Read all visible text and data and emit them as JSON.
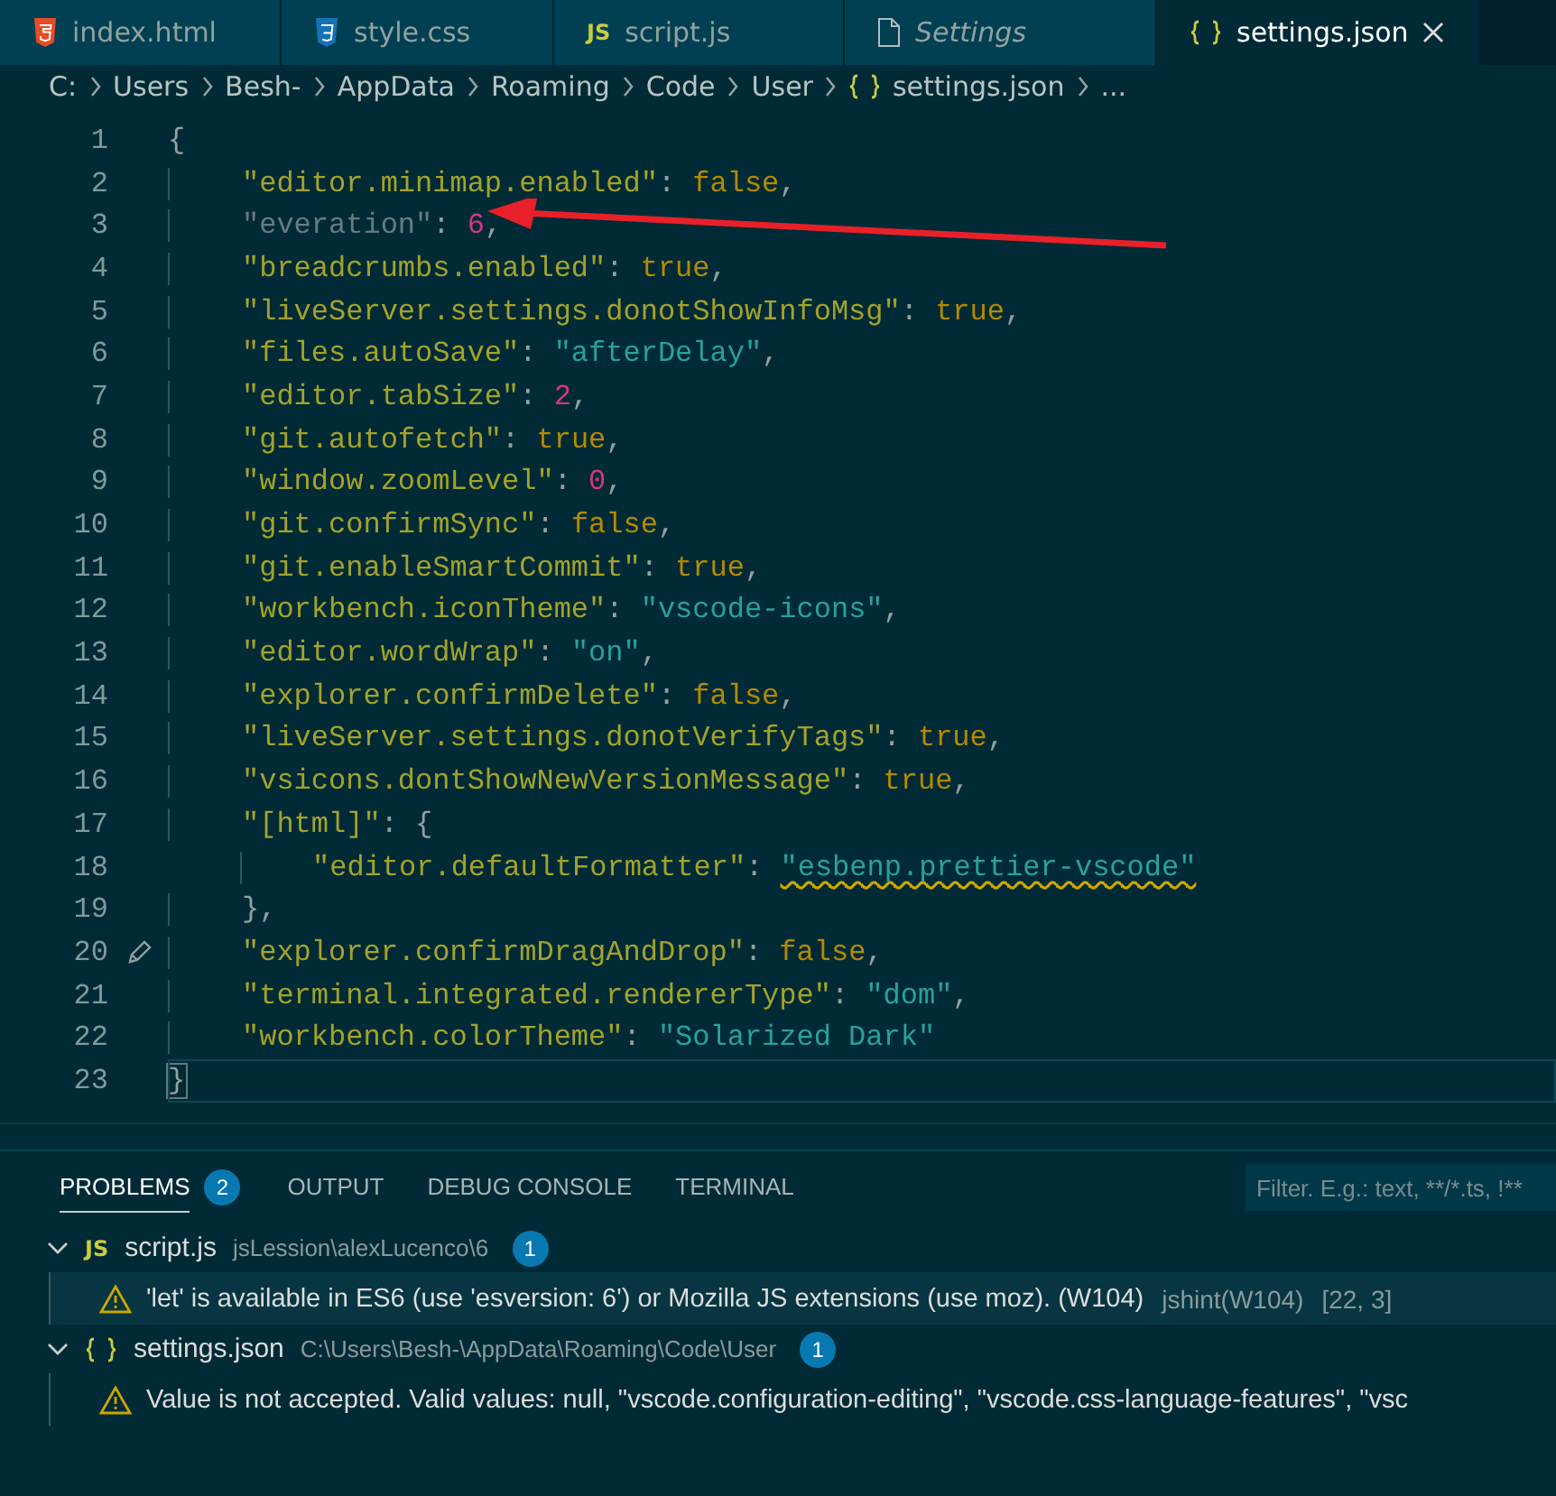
{
  "tabs": [
    {
      "label": "index.html",
      "kind": "html",
      "selected": false,
      "preview": false
    },
    {
      "label": "style.css",
      "kind": "css",
      "selected": false,
      "preview": false
    },
    {
      "label": "script.js",
      "kind": "script",
      "icon_text": "JS",
      "selected": false,
      "preview": false
    },
    {
      "label": "Settings",
      "kind": "plain",
      "selected": false,
      "preview": true
    },
    {
      "label": "settings.json",
      "kind": "braces",
      "selected": true,
      "preview": false
    }
  ],
  "breadcrumbs": [
    {
      "label": "C:",
      "kind": "folder"
    },
    {
      "label": "Users",
      "kind": "folder"
    },
    {
      "label": "Besh-",
      "kind": "folder"
    },
    {
      "label": "AppData",
      "kind": "folder"
    },
    {
      "label": "Roaming",
      "kind": "folder"
    },
    {
      "label": "Code",
      "kind": "folder"
    },
    {
      "label": "User",
      "kind": "folder"
    },
    {
      "label": "settings.json",
      "kind": "braces"
    },
    {
      "label": "...",
      "kind": "folder"
    }
  ],
  "editor": {
    "lines": [
      {
        "n": "1",
        "kind": "brace",
        "text": "{",
        "current": false
      },
      {
        "n": "2",
        "kind": "entry",
        "key": "\"editor.minimap.enabled\"",
        "colon": ":",
        "value": {
          "kind": "boolean",
          "text": "false"
        },
        "comma": ",",
        "unknown": false,
        "warning": false,
        "edited": false
      },
      {
        "n": "3",
        "kind": "entry",
        "key": "\"everation\"",
        "colon": ":",
        "value": {
          "kind": "number",
          "text": "6"
        },
        "comma": ",",
        "unknown": true,
        "warning": false,
        "edited": false
      },
      {
        "n": "4",
        "kind": "entry",
        "key": "\"breadcrumbs.enabled\"",
        "colon": ":",
        "value": {
          "kind": "boolean",
          "text": "true"
        },
        "comma": ",",
        "unknown": false,
        "warning": false,
        "edited": false
      },
      {
        "n": "5",
        "kind": "entry",
        "key": "\"liveServer.settings.donotShowInfoMsg\"",
        "colon": ":",
        "value": {
          "kind": "boolean",
          "text": "true"
        },
        "comma": ",",
        "unknown": false,
        "warning": false,
        "edited": false
      },
      {
        "n": "6",
        "kind": "entry",
        "key": "\"files.autoSave\"",
        "colon": ":",
        "value": {
          "kind": "string",
          "text": "\"afterDelay\""
        },
        "comma": ",",
        "unknown": false,
        "warning": false,
        "edited": false
      },
      {
        "n": "7",
        "kind": "entry",
        "key": "\"editor.tabSize\"",
        "colon": ":",
        "value": {
          "kind": "number",
          "text": "2"
        },
        "comma": ",",
        "unknown": false,
        "warning": false,
        "edited": false
      },
      {
        "n": "8",
        "kind": "entry",
        "key": "\"git.autofetch\"",
        "colon": ":",
        "value": {
          "kind": "boolean",
          "text": "true"
        },
        "comma": ",",
        "unknown": false,
        "warning": false,
        "edited": false
      },
      {
        "n": "9",
        "kind": "entry",
        "key": "\"window.zoomLevel\"",
        "colon": ":",
        "value": {
          "kind": "number",
          "text": "0"
        },
        "comma": ",",
        "unknown": false,
        "warning": false,
        "edited": false
      },
      {
        "n": "10",
        "kind": "entry",
        "key": "\"git.confirmSync\"",
        "colon": ":",
        "value": {
          "kind": "boolean",
          "text": "false"
        },
        "comma": ",",
        "unknown": false,
        "warning": false,
        "edited": false
      },
      {
        "n": "11",
        "kind": "entry",
        "key": "\"git.enableSmartCommit\"",
        "colon": ":",
        "value": {
          "kind": "boolean",
          "text": "true"
        },
        "comma": ",",
        "unknown": false,
        "warning": false,
        "edited": false
      },
      {
        "n": "12",
        "kind": "entry",
        "key": "\"workbench.iconTheme\"",
        "colon": ":",
        "value": {
          "kind": "string",
          "text": "\"vscode-icons\""
        },
        "comma": ",",
        "unknown": false,
        "warning": false,
        "edited": false
      },
      {
        "n": "13",
        "kind": "entry",
        "key": "\"editor.wordWrap\"",
        "colon": ":",
        "value": {
          "kind": "string",
          "text": "\"on\""
        },
        "comma": ",",
        "unknown": false,
        "warning": false,
        "edited": false
      },
      {
        "n": "14",
        "kind": "entry",
        "key": "\"explorer.confirmDelete\"",
        "colon": ":",
        "value": {
          "kind": "boolean",
          "text": "false"
        },
        "comma": ",",
        "unknown": false,
        "warning": false,
        "edited": false
      },
      {
        "n": "15",
        "kind": "entry",
        "key": "\"liveServer.settings.donotVerifyTags\"",
        "colon": ":",
        "value": {
          "kind": "boolean",
          "text": "true"
        },
        "comma": ",",
        "unknown": false,
        "warning": false,
        "edited": false
      },
      {
        "n": "16",
        "kind": "entry",
        "key": "\"vsicons.dontShowNewVersionMessage\"",
        "colon": ":",
        "value": {
          "kind": "boolean",
          "text": "true"
        },
        "comma": ",",
        "unknown": false,
        "warning": false,
        "edited": false
      },
      {
        "n": "17",
        "kind": "object",
        "key": "\"[html]\"",
        "colon": ":",
        "open": "{",
        "close_n": "19",
        "close": "},",
        "children": [
          {
            "n": "18",
            "kind": "entry",
            "key": "\"editor.defaultFormatter\"",
            "colon": ":",
            "value": {
              "kind": "string",
              "text": "\"esbenp.prettier-vscode\""
            },
            "unknown": false,
            "warning": true,
            "edited": false
          }
        ]
      },
      {
        "n": "20",
        "kind": "entry",
        "key": "\"explorer.confirmDragAndDrop\"",
        "colon": ":",
        "value": {
          "kind": "boolean",
          "text": "false"
        },
        "comma": ",",
        "unknown": false,
        "warning": false,
        "edited": true
      },
      {
        "n": "21",
        "kind": "entry",
        "key": "\"terminal.integrated.rendererType\"",
        "colon": ":",
        "value": {
          "kind": "string",
          "text": "\"dom\""
        },
        "comma": ",",
        "unknown": false,
        "warning": false,
        "edited": false
      },
      {
        "n": "22",
        "kind": "entry",
        "key": "\"workbench.colorTheme\"",
        "colon": ":",
        "value": {
          "kind": "string",
          "text": "\"Solarized Dark\""
        },
        "unknown": false,
        "warning": false,
        "edited": false
      },
      {
        "n": "23",
        "kind": "brace",
        "text": "}",
        "current": true
      }
    ]
  },
  "panel": {
    "tabs": [
      {
        "label": "PROBLEMS",
        "badge": "2",
        "selected": true
      },
      {
        "label": "OUTPUT",
        "selected": false
      },
      {
        "label": "DEBUG CONSOLE",
        "selected": false
      },
      {
        "label": "TERMINAL",
        "selected": false
      }
    ],
    "filter": {
      "placeholder": "Filter. E.g.: text, **/*.ts, !**"
    },
    "groups": [
      {
        "kind": "script",
        "icon_text": "JS",
        "file": "script.js",
        "path": "jsLession\\alexLucenco\\6",
        "count": "1",
        "expanded": true,
        "problems": [
          {
            "message": "'let' is available in ES6 (use 'esversion: 6') or Mozilla JS extensions (use moz). (W104)",
            "source": "jshint(W104)",
            "position": "[22, 3]",
            "selected": true
          }
        ]
      },
      {
        "kind": "braces",
        "file": "settings.json",
        "path": "C:\\Users\\Besh-\\AppData\\Roaming\\Code\\User",
        "count": "1",
        "expanded": true,
        "problems": [
          {
            "message": "Value is not accepted. Valid values: null, \"vscode.configuration-editing\", \"vscode.css-language-features\", \"vsc",
            "selected": false
          }
        ]
      }
    ]
  }
}
